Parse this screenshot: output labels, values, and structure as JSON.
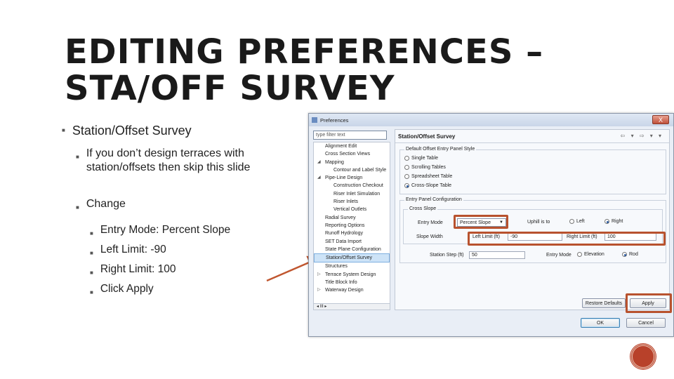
{
  "slide": {
    "title_line1": "EDITING PREFERENCES –",
    "title_line2": "STA/OFF SURVEY",
    "bullet1": "Station/Offset Survey",
    "sub1_line1": "If you don’t design terraces with",
    "sub1_line2": "station/offsets then skip this slide",
    "sub2": "Change",
    "items": [
      "Entry Mode: Percent Slope",
      "Left Limit: -90",
      "Right Limit: 100",
      "Click Apply"
    ]
  },
  "dialog": {
    "title": "Preferences",
    "close_glyph": "X",
    "filter_placeholder": "type filter text",
    "tree": [
      {
        "label": "Alignment Edit",
        "level": 0
      },
      {
        "label": "Cross Section Views",
        "level": 0
      },
      {
        "label": "Mapping",
        "level": 0,
        "toggle": "◢"
      },
      {
        "label": "Contour and Label Style",
        "level": 1
      },
      {
        "label": "Pipe-Line Design",
        "level": 0,
        "toggle": "◢"
      },
      {
        "label": "Construction Checkout",
        "level": 1
      },
      {
        "label": "Riser Inlet Simulation",
        "level": 1
      },
      {
        "label": "Riser Inlets",
        "level": 1
      },
      {
        "label": "Vertical Outlets",
        "level": 1
      },
      {
        "label": "Radial Survey",
        "level": 0
      },
      {
        "label": "Reporting Options",
        "level": 0
      },
      {
        "label": "Runoff Hydrology",
        "level": 0
      },
      {
        "label": "SET Data Import",
        "level": 0
      },
      {
        "label": "State Plane Configuration",
        "level": 0
      },
      {
        "label": "Station/Offset Survey",
        "level": 0,
        "selected": true
      },
      {
        "label": "Structures",
        "level": 0
      },
      {
        "label": "Terrace System Design",
        "level": 0,
        "toggle": "▷"
      },
      {
        "label": "Title Block Info",
        "level": 0
      },
      {
        "label": "Waterway Design",
        "level": 0,
        "toggle": "▷"
      }
    ],
    "scroll_text": "◂ III ▸",
    "page_title": "Station/Offset Survey",
    "nav_glyphs": "⇦ ▾ ⇨ ▾ ▾",
    "default_group_label": "Default Offset Entry Panel Style",
    "style_options": [
      {
        "label": "Single Table",
        "selected": false
      },
      {
        "label": "Scrolling Tables",
        "selected": false
      },
      {
        "label": "Spreadsheet Table",
        "selected": false
      },
      {
        "label": "Cross-Slope Table",
        "selected": true
      }
    ],
    "config_group_label": "Entry Panel Configuration",
    "cross_slope_label": "Cross Slope",
    "entry_mode_label": "Entry Mode",
    "entry_mode_value": "Percent Slope",
    "uphill_label": "Uphill is to",
    "uphill_left": "Left",
    "uphill_right": "Right",
    "slope_width_label": "Slope Width",
    "left_limit_label": "Left Limit (ft)",
    "left_limit_value": "-90",
    "right_limit_label": "Right Limit (ft)",
    "right_limit_value": "100",
    "station_step_label": "Station Step (ft)",
    "station_step_value": "50",
    "entry_mode2_label": "Entry Mode",
    "entry_mode2_elev": "Elevation",
    "entry_mode2_rod": "Rod",
    "restore_label": "Restore Defaults",
    "apply_label": "Apply",
    "ok_label": "OK",
    "cancel_label": "Cancel"
  },
  "colors": {
    "highlight": "#b8522e",
    "arrow": "#c0562f"
  }
}
